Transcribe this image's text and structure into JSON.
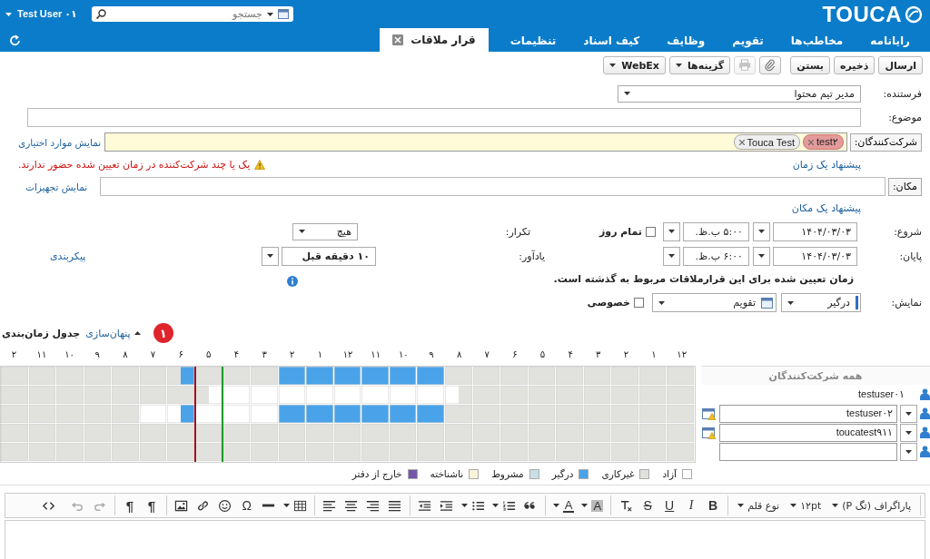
{
  "header": {
    "logo": "TOUCA",
    "search": {
      "placeholder": "جستجو"
    },
    "user": "Test User ۰۱"
  },
  "nav_tabs": [
    {
      "label": "رایانامه",
      "selected": false,
      "closable": false
    },
    {
      "label": "مخاطب‌ها",
      "selected": false,
      "closable": false
    },
    {
      "label": "تقویم",
      "selected": false,
      "closable": false
    },
    {
      "label": "وظایف",
      "selected": false,
      "closable": false
    },
    {
      "label": "کیف اسناد",
      "selected": false,
      "closable": false
    },
    {
      "label": "تنظیمات",
      "selected": false,
      "closable": false
    },
    {
      "label": "قرار ملاقات",
      "selected": true,
      "closable": true
    }
  ],
  "toolbar": [
    {
      "kind": "button",
      "label": "ارسال"
    },
    {
      "kind": "button",
      "label": "ذخیره"
    },
    {
      "kind": "button",
      "label": "بستن"
    },
    {
      "kind": "attach",
      "disabled": false
    },
    {
      "kind": "print",
      "disabled": true
    },
    {
      "kind": "menu",
      "label": "گزینه‌ها"
    },
    {
      "kind": "menu",
      "label": "WebEx"
    }
  ],
  "form": {
    "sender": {
      "label": "فرستنده:",
      "value": "مدیر تیم محتوا"
    },
    "subject": {
      "label": "موضوع:"
    },
    "attendees": {
      "label": "شرکت‌کنندگان:",
      "chips": [
        {
          "label": "test۲",
          "available": false
        },
        {
          "label": "Touca Test",
          "available": true
        }
      ],
      "link": "نمایش موارد اختیاری"
    },
    "suggest_time": "پیشنهاد یک زمان",
    "warning": "یک یا چند شرکت‌کننده در زمان تعیین شده حضور ندارند.",
    "location": {
      "label": "مکان:",
      "link": "نمایش تجهیزات"
    },
    "suggest_location": "پیشنهاد یک مکان",
    "start": {
      "label": "شروع:",
      "date": "۱۴۰۴/۰۳/۰۳",
      "time": "۵:۰۰ ب.ظ."
    },
    "all_day": {
      "label": "تمام روز",
      "checked": false
    },
    "repeat": {
      "label": "تکرار:",
      "value": "هیچ"
    },
    "end": {
      "label": "پایان:",
      "date": "۱۴۰۴/۰۳/۰۳",
      "time": "۶:۰۰ ب.ظ."
    },
    "reminder": {
      "label": "یادآور:",
      "value": "۱۰ دقیقه قبل"
    },
    "configure_link": "پیکربندی",
    "past_notice": "زمان تعیین شده برای این قرارملاقات مربوط به گذشته است.",
    "show_as": {
      "label": "نمایش:",
      "status": "درگیر",
      "color": "#2e6fc0",
      "calendar": "تقویم"
    },
    "private": {
      "label": "خصوصی",
      "checked": false
    }
  },
  "schedule": {
    "badge": "۱",
    "toggle": "پنهان‌سازی",
    "title": "جدول زمان‌بندی",
    "hours": [
      {
        "label": "۱۲",
        "meeting": false
      },
      {
        "label": "۱",
        "meeting": false
      },
      {
        "label": "۲",
        "meeting": false
      },
      {
        "label": "۳",
        "meeting": false
      },
      {
        "label": "۴",
        "meeting": false
      },
      {
        "label": "۵",
        "meeting": false
      },
      {
        "label": "۶",
        "meeting": false
      },
      {
        "label": "۷",
        "meeting": false
      },
      {
        "label": "۸",
        "meeting": false
      },
      {
        "label": "۹",
        "meeting": false
      },
      {
        "label": "۱۰",
        "meeting": false
      },
      {
        "label": "۱۱",
        "meeting": false
      },
      {
        "label": "۱۲",
        "meeting": false
      },
      {
        "label": "۱",
        "meeting": false
      },
      {
        "label": "۲",
        "meeting": false
      },
      {
        "label": "۳",
        "meeting": false
      },
      {
        "label": "۴",
        "meeting": false
      },
      {
        "label": "۵",
        "meeting": true
      },
      {
        "label": "۶",
        "meeting": false
      },
      {
        "label": "۷",
        "meeting": false
      },
      {
        "label": "۸",
        "meeting": false
      },
      {
        "label": "۹",
        "meeting": false
      },
      {
        "label": "۱۰",
        "meeting": false
      },
      {
        "label": "۱۱",
        "meeting": false
      },
      {
        "label": "۲",
        "meeting": false
      }
    ],
    "rows": [
      {
        "kind": "summary",
        "name": "همه شرکت‌کنندگان",
        "slots": [
          {
            "kind": "off"
          },
          {
            "kind": "off"
          },
          {
            "kind": "off"
          },
          {
            "kind": "off"
          },
          {
            "kind": "off"
          },
          {
            "kind": "off"
          },
          {
            "kind": "off"
          },
          {
            "kind": "off"
          },
          {
            "kind": "off"
          },
          {
            "kind": "off"
          },
          {
            "kind": "off"
          },
          {
            "kind": "off"
          },
          {
            "kind": "off"
          },
          {
            "kind": "off"
          },
          {
            "kind": "off"
          },
          {
            "kind": "off"
          },
          {
            "kind": "off"
          },
          {
            "kind": "off"
          },
          {
            "kind": "busy"
          },
          {
            "kind": "busy"
          },
          {
            "kind": "busy"
          },
          {
            "kind": "busy"
          },
          {
            "kind": "busy"
          },
          {
            "kind": "busy"
          },
          {
            "kind": "busy"
          },
          {
            "kind": "busy"
          },
          {
            "kind": "busy"
          },
          {
            "kind": "busy"
          },
          {
            "kind": "busy"
          },
          {
            "kind": "busy"
          },
          {
            "kind": "off"
          },
          {
            "kind": "off"
          },
          {
            "kind": "off"
          },
          {
            "kind": "off"
          },
          {
            "kind": "off"
          },
          {
            "kind": "off"
          },
          {
            "kind": "busy"
          },
          {
            "kind": "off"
          },
          {
            "kind": "off"
          },
          {
            "kind": "off"
          },
          {
            "kind": "off"
          },
          {
            "kind": "off"
          },
          {
            "kind": "off"
          },
          {
            "kind": "off"
          },
          {
            "kind": "off"
          },
          {
            "kind": "off"
          },
          {
            "kind": "off"
          },
          {
            "kind": "off"
          },
          {
            "kind": "off"
          },
          {
            "kind": "off"
          }
        ]
      },
      {
        "kind": "organizer",
        "name": "testuser۰۱",
        "slots": [
          {
            "kind": "off"
          },
          {
            "kind": "off"
          },
          {
            "kind": "off"
          },
          {
            "kind": "off"
          },
          {
            "kind": "off"
          },
          {
            "kind": "off"
          },
          {
            "kind": "off"
          },
          {
            "kind": "off"
          },
          {
            "kind": "off"
          },
          {
            "kind": "off"
          },
          {
            "kind": "off"
          },
          {
            "kind": "off"
          },
          {
            "kind": "off"
          },
          {
            "kind": "off"
          },
          {
            "kind": "off"
          },
          {
            "kind": "off"
          },
          {
            "kind": "off"
          },
          {
            "kind": "free"
          },
          {
            "kind": "free"
          },
          {
            "kind": "free"
          },
          {
            "kind": "free"
          },
          {
            "kind": "free"
          },
          {
            "kind": "free"
          },
          {
            "kind": "free"
          },
          {
            "kind": "free"
          },
          {
            "kind": "free"
          },
          {
            "kind": "free"
          },
          {
            "kind": "free"
          },
          {
            "kind": "free"
          },
          {
            "kind": "free"
          },
          {
            "kind": "free"
          },
          {
            "kind": "free"
          },
          {
            "kind": "free"
          },
          {
            "kind": "free"
          },
          {
            "kind": "free"
          },
          {
            "kind": "off"
          },
          {
            "kind": "off"
          },
          {
            "kind": "off"
          },
          {
            "kind": "off"
          },
          {
            "kind": "off"
          },
          {
            "kind": "off"
          },
          {
            "kind": "off"
          },
          {
            "kind": "off"
          },
          {
            "kind": "off"
          },
          {
            "kind": "off"
          },
          {
            "kind": "off"
          },
          {
            "kind": "off"
          },
          {
            "kind": "off"
          },
          {
            "kind": "off"
          },
          {
            "kind": "off"
          }
        ]
      },
      {
        "kind": "attendee",
        "name": "testuser۰۲",
        "warning": true,
        "slots": [
          {
            "kind": "off"
          },
          {
            "kind": "off"
          },
          {
            "kind": "off"
          },
          {
            "kind": "off"
          },
          {
            "kind": "off"
          },
          {
            "kind": "off"
          },
          {
            "kind": "off"
          },
          {
            "kind": "off"
          },
          {
            "kind": "off"
          },
          {
            "kind": "off"
          },
          {
            "kind": "off"
          },
          {
            "kind": "off"
          },
          {
            "kind": "off"
          },
          {
            "kind": "off"
          },
          {
            "kind": "off"
          },
          {
            "kind": "off"
          },
          {
            "kind": "off"
          },
          {
            "kind": "off"
          },
          {
            "kind": "busy"
          },
          {
            "kind": "busy"
          },
          {
            "kind": "busy"
          },
          {
            "kind": "busy"
          },
          {
            "kind": "busy"
          },
          {
            "kind": "busy"
          },
          {
            "kind": "busy"
          },
          {
            "kind": "busy"
          },
          {
            "kind": "busy"
          },
          {
            "kind": "busy"
          },
          {
            "kind": "busy"
          },
          {
            "kind": "busy"
          },
          {
            "kind": "free"
          },
          {
            "kind": "free"
          },
          {
            "kind": "free"
          },
          {
            "kind": "free"
          },
          {
            "kind": "free"
          },
          {
            "kind": "free"
          },
          {
            "kind": "busy"
          },
          {
            "kind": "free"
          },
          {
            "kind": "free"
          },
          {
            "kind": "free"
          },
          {
            "kind": "off"
          },
          {
            "kind": "off"
          },
          {
            "kind": "off"
          },
          {
            "kind": "off"
          },
          {
            "kind": "off"
          },
          {
            "kind": "off"
          },
          {
            "kind": "off"
          },
          {
            "kind": "off"
          },
          {
            "kind": "off"
          },
          {
            "kind": "off"
          }
        ]
      },
      {
        "kind": "attendee",
        "name": "toucatest۹۱۱",
        "warning": true,
        "slots": [
          {
            "kind": "off"
          },
          {
            "kind": "off"
          },
          {
            "kind": "off"
          },
          {
            "kind": "off"
          },
          {
            "kind": "off"
          },
          {
            "kind": "off"
          },
          {
            "kind": "off"
          },
          {
            "kind": "off"
          },
          {
            "kind": "off"
          },
          {
            "kind": "off"
          },
          {
            "kind": "off"
          },
          {
            "kind": "off"
          },
          {
            "kind": "off"
          },
          {
            "kind": "off"
          },
          {
            "kind": "off"
          },
          {
            "kind": "off"
          },
          {
            "kind": "off"
          },
          {
            "kind": "off"
          },
          {
            "kind": "off"
          },
          {
            "kind": "off"
          },
          {
            "kind": "off"
          },
          {
            "kind": "off"
          },
          {
            "kind": "off"
          },
          {
            "kind": "off"
          },
          {
            "kind": "off"
          },
          {
            "kind": "off"
          },
          {
            "kind": "off"
          },
          {
            "kind": "off"
          },
          {
            "kind": "off"
          },
          {
            "kind": "off"
          },
          {
            "kind": "off"
          },
          {
            "kind": "off"
          },
          {
            "kind": "off"
          },
          {
            "kind": "off"
          },
          {
            "kind": "off"
          },
          {
            "kind": "off"
          },
          {
            "kind": "off"
          },
          {
            "kind": "off"
          },
          {
            "kind": "off"
          },
          {
            "kind": "off"
          },
          {
            "kind": "off"
          },
          {
            "kind": "off"
          },
          {
            "kind": "off"
          },
          {
            "kind": "off"
          },
          {
            "kind": "off"
          },
          {
            "kind": "off"
          },
          {
            "kind": "off"
          },
          {
            "kind": "off"
          },
          {
            "kind": "off"
          },
          {
            "kind": "off"
          }
        ]
      },
      {
        "kind": "new",
        "warning": false,
        "slots": [
          {
            "kind": "off"
          },
          {
            "kind": "off"
          },
          {
            "kind": "off"
          },
          {
            "kind": "off"
          },
          {
            "kind": "off"
          },
          {
            "kind": "off"
          },
          {
            "kind": "off"
          },
          {
            "kind": "off"
          },
          {
            "kind": "off"
          },
          {
            "kind": "off"
          },
          {
            "kind": "off"
          },
          {
            "kind": "off"
          },
          {
            "kind": "off"
          },
          {
            "kind": "off"
          },
          {
            "kind": "off"
          },
          {
            "kind": "off"
          },
          {
            "kind": "off"
          },
          {
            "kind": "off"
          },
          {
            "kind": "off"
          },
          {
            "kind": "off"
          },
          {
            "kind": "off"
          },
          {
            "kind": "off"
          },
          {
            "kind": "off"
          },
          {
            "kind": "off"
          },
          {
            "kind": "off"
          },
          {
            "kind": "off"
          },
          {
            "kind": "off"
          },
          {
            "kind": "off"
          },
          {
            "kind": "off"
          },
          {
            "kind": "off"
          },
          {
            "kind": "off"
          },
          {
            "kind": "off"
          },
          {
            "kind": "off"
          },
          {
            "kind": "off"
          },
          {
            "kind": "off"
          },
          {
            "kind": "off"
          },
          {
            "kind": "off"
          },
          {
            "kind": "off"
          },
          {
            "kind": "off"
          },
          {
            "kind": "off"
          },
          {
            "kind": "off"
          },
          {
            "kind": "off"
          },
          {
            "kind": "off"
          },
          {
            "kind": "off"
          },
          {
            "kind": "off"
          },
          {
            "kind": "off"
          },
          {
            "kind": "off"
          },
          {
            "kind": "off"
          },
          {
            "kind": "off"
          },
          {
            "kind": "off"
          }
        ]
      }
    ],
    "legend": [
      {
        "label": "آزاد",
        "color": "#ffffff"
      },
      {
        "label": "غیرکاری",
        "color": "#e0e0dc"
      },
      {
        "label": "درگیر",
        "color": "#4aa3e8"
      },
      {
        "label": "مشروط",
        "color": "#c9dfe5"
      },
      {
        "label": "ناشناخته",
        "color": "#f7f3d6"
      },
      {
        "label": "خارج از دفتر",
        "color": "#7656a8"
      }
    ]
  },
  "editor": {
    "toolbar": [
      [
        {
          "kind": "select",
          "label": "پاراگراف (تگ P)"
        },
        {
          "kind": "select",
          "label": "۱۲pt"
        },
        {
          "kind": "select",
          "label": "نوع قلم"
        }
      ],
      [
        {
          "kind": "bold",
          "label": "B"
        },
        {
          "kind": "italic",
          "label": "I"
        },
        {
          "kind": "underline",
          "label": "U"
        },
        {
          "kind": "strike",
          "label": "S"
        },
        {
          "kind": "clear"
        }
      ],
      [
        {
          "kind": "background-color",
          "label": "A"
        },
        {
          "kind": "text-color",
          "label": "A"
        }
      ],
      [
        {
          "kind": "quote"
        },
        {
          "kind": "numbered",
          "dropdown": true
        },
        {
          "kind": "bullets",
          "dropdown": true
        },
        {
          "kind": "indent"
        },
        {
          "kind": "outdent"
        }
      ],
      [
        {
          "kind": "justify"
        },
        {
          "kind": "align-right"
        },
        {
          "kind": "align-center"
        },
        {
          "kind": "align-left"
        }
      ],
      [
        {
          "kind": "table",
          "dropdown": true
        },
        {
          "kind": "rule"
        },
        {
          "kind": "symbol",
          "label": "Ω"
        },
        {
          "kind": "smiley"
        },
        {
          "kind": "link"
        },
        {
          "kind": "image"
        }
      ],
      [
        {
          "kind": "paragraph",
          "label": "¶"
        },
        {
          "kind": "paragraph",
          "label": "¶"
        }
      ],
      [
        {
          "kind": "redo",
          "disabled": true
        },
        {
          "kind": "undo",
          "disabled": true
        }
      ],
      [
        {
          "kind": "code"
        }
      ]
    ]
  }
}
